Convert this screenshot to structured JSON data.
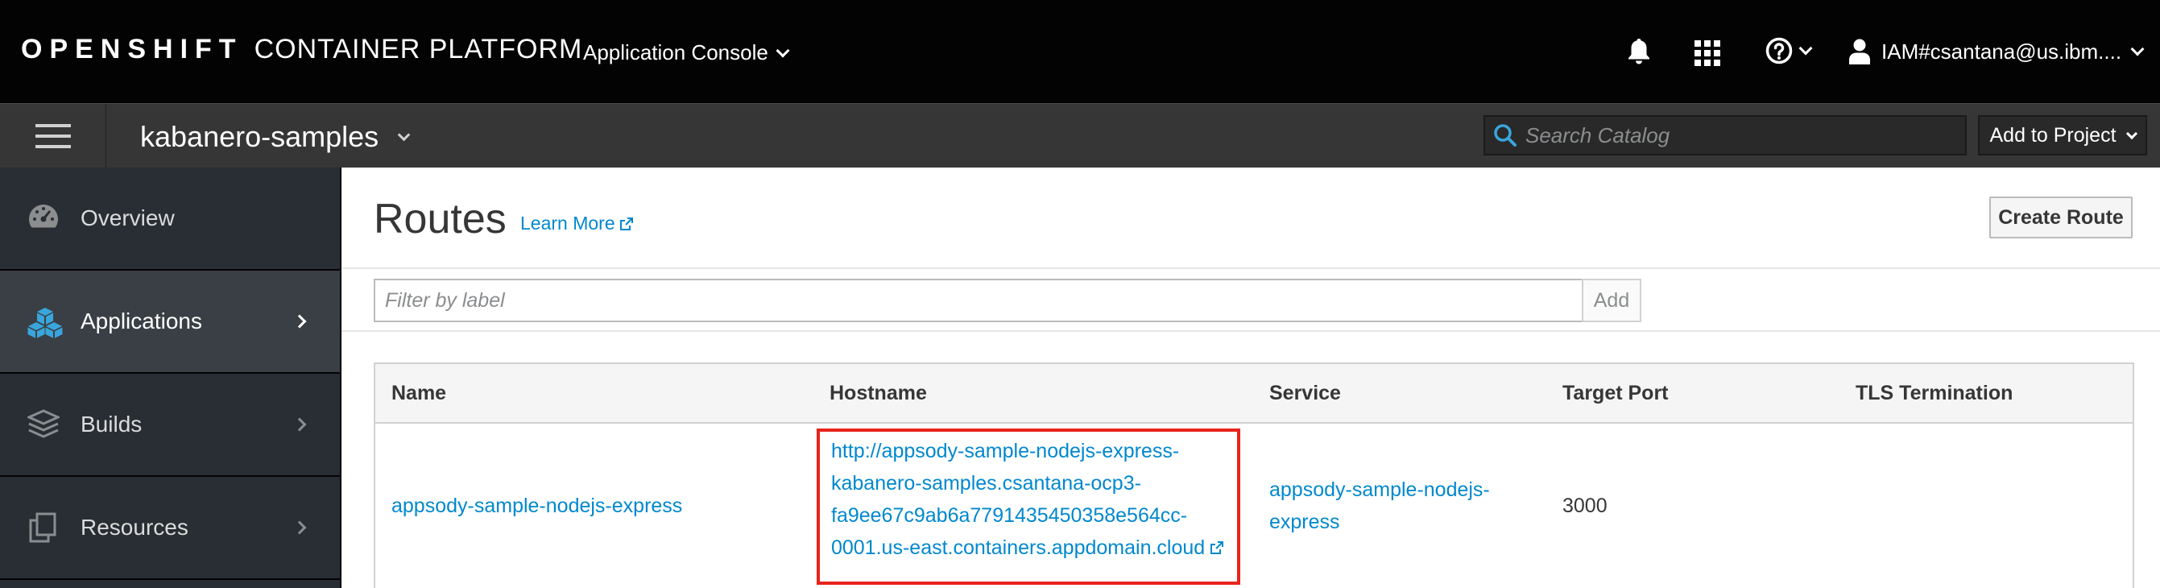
{
  "masthead": {
    "brand_bold": "OPENSHIFT",
    "brand_rest": "CONTAINER PLATFORM",
    "console_label": "Application Console",
    "user_label": "IAM#csantana@us.ibm...."
  },
  "projectbar": {
    "project_name": "kabanero-samples",
    "search_placeholder": "Search Catalog",
    "add_to_project": "Add to Project"
  },
  "sidebar": {
    "items": [
      {
        "label": "Overview",
        "icon": "dashboard-icon"
      },
      {
        "label": "Applications",
        "icon": "cubes-icon"
      },
      {
        "label": "Builds",
        "icon": "layers-icon"
      },
      {
        "label": "Resources",
        "icon": "copy-icon"
      }
    ]
  },
  "main": {
    "title": "Routes",
    "learn_more": "Learn More",
    "create_route": "Create Route",
    "filter_placeholder": "Filter by label",
    "add_label": "Add"
  },
  "table": {
    "headers": [
      "Name",
      "Hostname",
      "Service",
      "Target Port",
      "TLS Termination"
    ],
    "rows": [
      {
        "name": "appsody-sample-nodejs-express",
        "hostname_lines": [
          "http://appsody-sample-nodejs-express-",
          "kabanero-samples.csantana-ocp3-",
          "fa9ee67c9ab6a7791435450358e564cc-",
          "0001.us-east.containers.appdomain.cloud"
        ],
        "service_lines": [
          "appsody-sample-nodejs-",
          "express"
        ],
        "target_port": "3000",
        "tls": ""
      }
    ]
  },
  "colors": {
    "masthead": "#030303",
    "projectbar": "#363636",
    "sidebar": "#292e34",
    "link": "#0088ce",
    "highlight": "#e8231b"
  }
}
